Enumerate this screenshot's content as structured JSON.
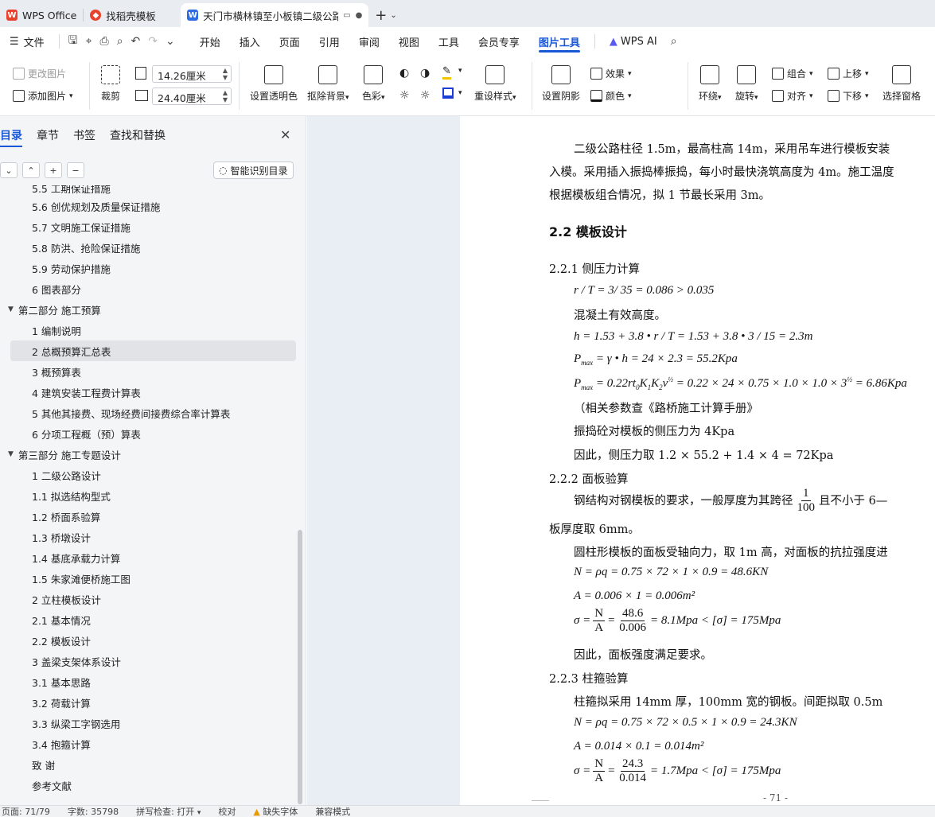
{
  "tabs": [
    {
      "label": "WPS Office",
      "icon": "wps-logo-icon",
      "color": "#e8412d"
    },
    {
      "label": "找稻壳模板",
      "icon": "docer-logo-icon",
      "color": "#e8412d"
    },
    {
      "label": "天门市横林镇至小板镇二级公路",
      "icon": "writer-doc-icon",
      "color": "#2f6be5",
      "active": true
    }
  ],
  "menu": {
    "file": "文件",
    "items": [
      "开始",
      "插入",
      "页面",
      "引用",
      "审阅",
      "视图",
      "工具",
      "会员专享",
      "图片工具"
    ],
    "active": "图片工具",
    "wps_ai": "WPS AI"
  },
  "ribbon": {
    "change_image": "更改图片",
    "add_image": "添加图片",
    "crop": "裁剪",
    "width_value": "14.26厘米",
    "height_value": "24.40厘米",
    "set_transparent": "设置透明色",
    "remove_bg": "抠除背景",
    "color_adjust": "色彩",
    "redo_style": "重设样式",
    "set_shadow": "设置阴影",
    "effect": "效果",
    "color": "颜色",
    "wrap": "环绕",
    "rotate": "旋转",
    "group": "组合",
    "align": "对齐",
    "move_up": "上移",
    "move_down": "下移",
    "selection_pane": "选择窗格"
  },
  "nav": {
    "tabs": [
      "目录",
      "章节",
      "书签",
      "查找和替换"
    ],
    "active_tab": "目录",
    "smart_toc": "智能识别目录",
    "items": [
      {
        "label": "5.5  工期保证措施",
        "level": 2
      },
      {
        "label": "5.6  创优规划及质量保证措施",
        "level": 2
      },
      {
        "label": "5.7  文明施工保证措施",
        "level": 2
      },
      {
        "label": "5.8  防洪、抢险保证措施",
        "level": 2
      },
      {
        "label": "5.9  劳动保护措施",
        "level": 2
      },
      {
        "label": "6  图表部分",
        "level": 2
      },
      {
        "label": "第二部分  施工预算",
        "level": 1
      },
      {
        "label": "1  编制说明",
        "level": 2
      },
      {
        "label": "2  总概预算汇总表",
        "level": 2,
        "selected": true
      },
      {
        "label": "3  概预算表",
        "level": 2
      },
      {
        "label": "4  建筑安装工程费计算表",
        "level": 2
      },
      {
        "label": "5  其他其接费、现场经费间接费综合率计算表",
        "level": 2
      },
      {
        "label": "6  分项工程概（预）算表",
        "level": 2
      },
      {
        "label": "第三部分  施工专题设计",
        "level": 1
      },
      {
        "label": "1  二级公路设计",
        "level": 2
      },
      {
        "label": "1.1  拟选结构型式",
        "level": 2
      },
      {
        "label": "1.2  桥面系验算",
        "level": 2
      },
      {
        "label": "1.3  桥墩设计",
        "level": 2
      },
      {
        "label": "1.4  基底承载力计算",
        "level": 2
      },
      {
        "label": "1.5  朱家滩便桥施工图",
        "level": 2
      },
      {
        "label": "2  立柱模板设计",
        "level": 2
      },
      {
        "label": "2.1  基本情况",
        "level": 2
      },
      {
        "label": "2.2  模板设计",
        "level": 2
      },
      {
        "label": "3  盖梁支架体系设计",
        "level": 2
      },
      {
        "label": "3.1  基本思路",
        "level": 2
      },
      {
        "label": "3.2  荷载计算",
        "level": 2
      },
      {
        "label": "3.3  纵梁工字钢选用",
        "level": 2
      },
      {
        "label": "3.4  抱箍计算",
        "level": 2
      },
      {
        "label": "致      谢",
        "level": 2
      },
      {
        "label": "参考文献",
        "level": 2
      }
    ]
  },
  "doc": {
    "p1_l1": "二级公路柱径 1.5m，最高柱高 14m，采用吊车进行模板安装",
    "p1_l2": "入模。采用插入振捣棒振捣，每小时最快浇筑高度为 4m。施工温度",
    "p1_l3": "根据模板组合情况，拟 1 节最长采用 3m。",
    "h_22": "2.2  模板设计",
    "h_221": "2.2.1  侧压力计算",
    "eq1": "r / T = 3/ 35 = 0.086 > 0.035",
    "t_concrete": "混凝土有效高度。",
    "eq2": "h = 1.53 + 3.8 • r / T = 1.53 + 3.8 • 3 / 15 = 2.3m",
    "eq3_lhs": "P",
    "eq3_sub": "max",
    "eq3_rhs": " = γ • h = 24 × 2.3 = 55.2Kpa",
    "eq4_a": " = 0.22rt",
    "eq4_b": "K",
    "eq4_c": "K",
    "eq4_d": "v",
    "eq4_e": " = 0.22 × 24 × 0.75 × 1.0 × 1.0 × 3",
    "eq4_f": " = 6.86Kpa",
    "eq4_exp": "½",
    "t_ref": "（相关参数查《路桥施工计算手册》",
    "t_vibe": "振捣砼对模板的侧压力为 4Kpa",
    "t_thus": "因此，侧压力取 1.2 × 55.2 + 1.4 × 4 = 72Kpa",
    "h_222": "2.2.2  面板验算",
    "t_steel1a": "钢结构对钢模板的要求，一般厚度为其跨径",
    "t_steel1_num": "1",
    "t_steel1_den": "100",
    "t_steel1b": "且不小于 6—",
    "t_steel2": "板厚度取 6mm。",
    "t_cyl": "圆柱形模板的面板受轴向力，取 1m 高，对面板的抗拉强度进",
    "eq5": "N = ρq = 0.75 × 72 × 1 × 0.9 = 48.6KN",
    "eq6": "A = 0.006 × 1 = 0.006m²",
    "eq7_num": "N",
    "eq7_den": "A",
    "eq7_num2": "48.6",
    "eq7_den2": "0.006",
    "eq7_rhs": "= 8.1Mpa < [σ] = 175Mpa",
    "t_ok": "因此，面板强度满足要求。",
    "h_223": "2.2.3  柱箍验算",
    "t_hoop": "柱箍拟采用 14mm 厚，100mm 宽的钢板。间距拟取 0.5m",
    "eq8": "N = ρq = 0.75 × 72 × 0.5 × 1 × 0.9 = 24.3KN",
    "eq9": "A = 0.014 × 0.1 = 0.014m²",
    "eq10_num2": "24.3",
    "eq10_den2": "0.014",
    "eq10_rhs": "= 1.7Mpa < [σ] = 175Mpa",
    "page_num": "- 71 -"
  },
  "status": {
    "page": "页面: 71/79",
    "words": "字数: 35798",
    "spell": "拼写检查: 打开",
    "proof": "校对",
    "missing_font": "缺失字体",
    "compat": "兼容模式"
  },
  "colors": {
    "accent": "#1a57d6",
    "nav_bg": "#f3f5f7",
    "doc_bg": "#e8eef3"
  }
}
